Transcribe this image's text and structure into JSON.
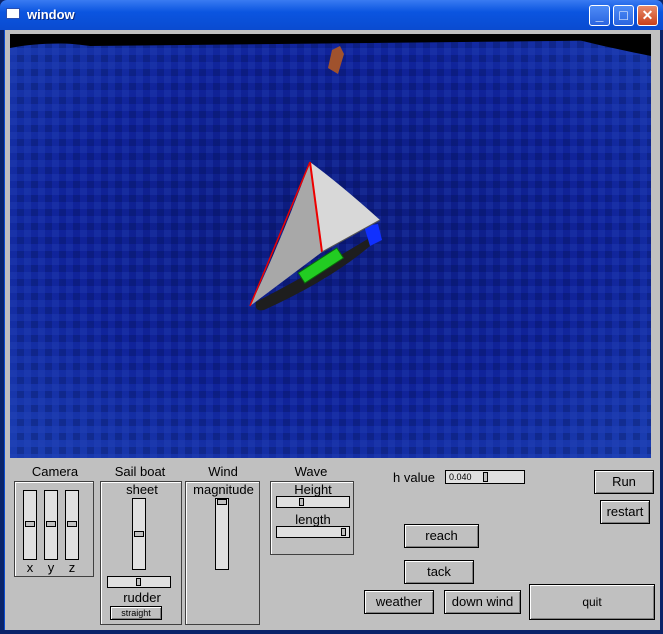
{
  "window": {
    "title": "window"
  },
  "panels": {
    "camera": {
      "title": "Camera",
      "axes": [
        "x",
        "y",
        "z"
      ],
      "levels": [
        0.5,
        0.5,
        0.5
      ]
    },
    "sailboat": {
      "title": "Sail boat",
      "sheet_label": "sheet",
      "sheet_level": 0.45,
      "rudder_label": "rudder",
      "rudder_level": 0.5,
      "straight_label": "straight"
    },
    "wind": {
      "title": "Wind",
      "magnitude_label": "magnitude",
      "magnitude_level": 0.0
    },
    "wave": {
      "title": "Wave",
      "height_label": "Height",
      "height_level": 0.35,
      "length_label": "length",
      "length_level": 0.95
    }
  },
  "hvalue": {
    "label": "h value",
    "value": "0.040",
    "level": 0.5
  },
  "buttons": {
    "run": "Run",
    "restart": "restart",
    "reach": "reach",
    "tack": "tack",
    "weather": "weather",
    "down_wind": "down wind",
    "quit": "quit"
  },
  "colors": {
    "sea": "#0d1f8a",
    "hull": "#1a1a1a",
    "sail": "#b8b8b8",
    "deck": "#22cc22"
  }
}
